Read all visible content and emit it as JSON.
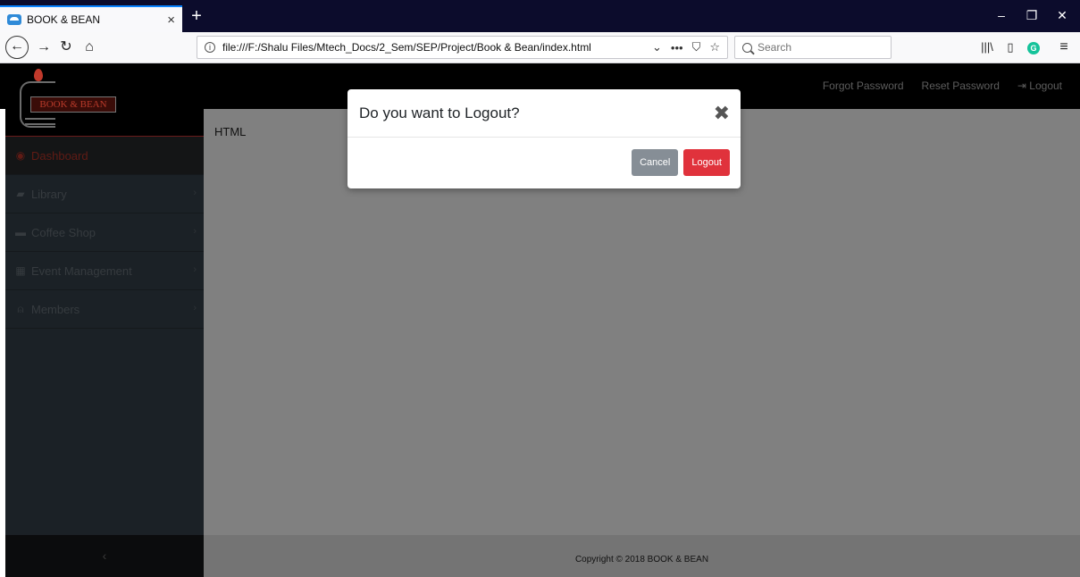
{
  "browser": {
    "tab_title": "BOOK & BEAN",
    "tab_close": "×",
    "new_tab": "+",
    "url": "file:///F:/Shalu Files/Mtech_Docs/2_Sem/SEP/Project/Book & Bean/index.html",
    "search_placeholder": "Search",
    "window_controls": [
      "–",
      "❐",
      "✕"
    ]
  },
  "app": {
    "logo_text": "BOOK & BEAN",
    "topnav": {
      "forgot_password": "Forgot Password",
      "reset_password": "Reset Password",
      "logout": "Logout"
    },
    "sidebar": {
      "items": [
        {
          "label": "Dashboard",
          "icon": "dashboard-icon"
        },
        {
          "label": "Library",
          "icon": "book-icon"
        },
        {
          "label": "Coffee Shop",
          "icon": "coffee-icon"
        },
        {
          "label": "Event Management",
          "icon": "calendar-icon"
        },
        {
          "label": "Members",
          "icon": "user-icon"
        }
      ],
      "collapse_glyph": "‹"
    },
    "content_label": "HTML",
    "footer": "Copyright © 2018 BOOK & BEAN"
  },
  "modal": {
    "title": "Do you want to Logout?",
    "close_glyph": "✖",
    "cancel_label": "Cancel",
    "logout_label": "Logout"
  },
  "colors": {
    "accent": "#0a84ff",
    "logout_button": "#e0323c",
    "cancel_button": "#868e96",
    "overlay": "#808080"
  }
}
